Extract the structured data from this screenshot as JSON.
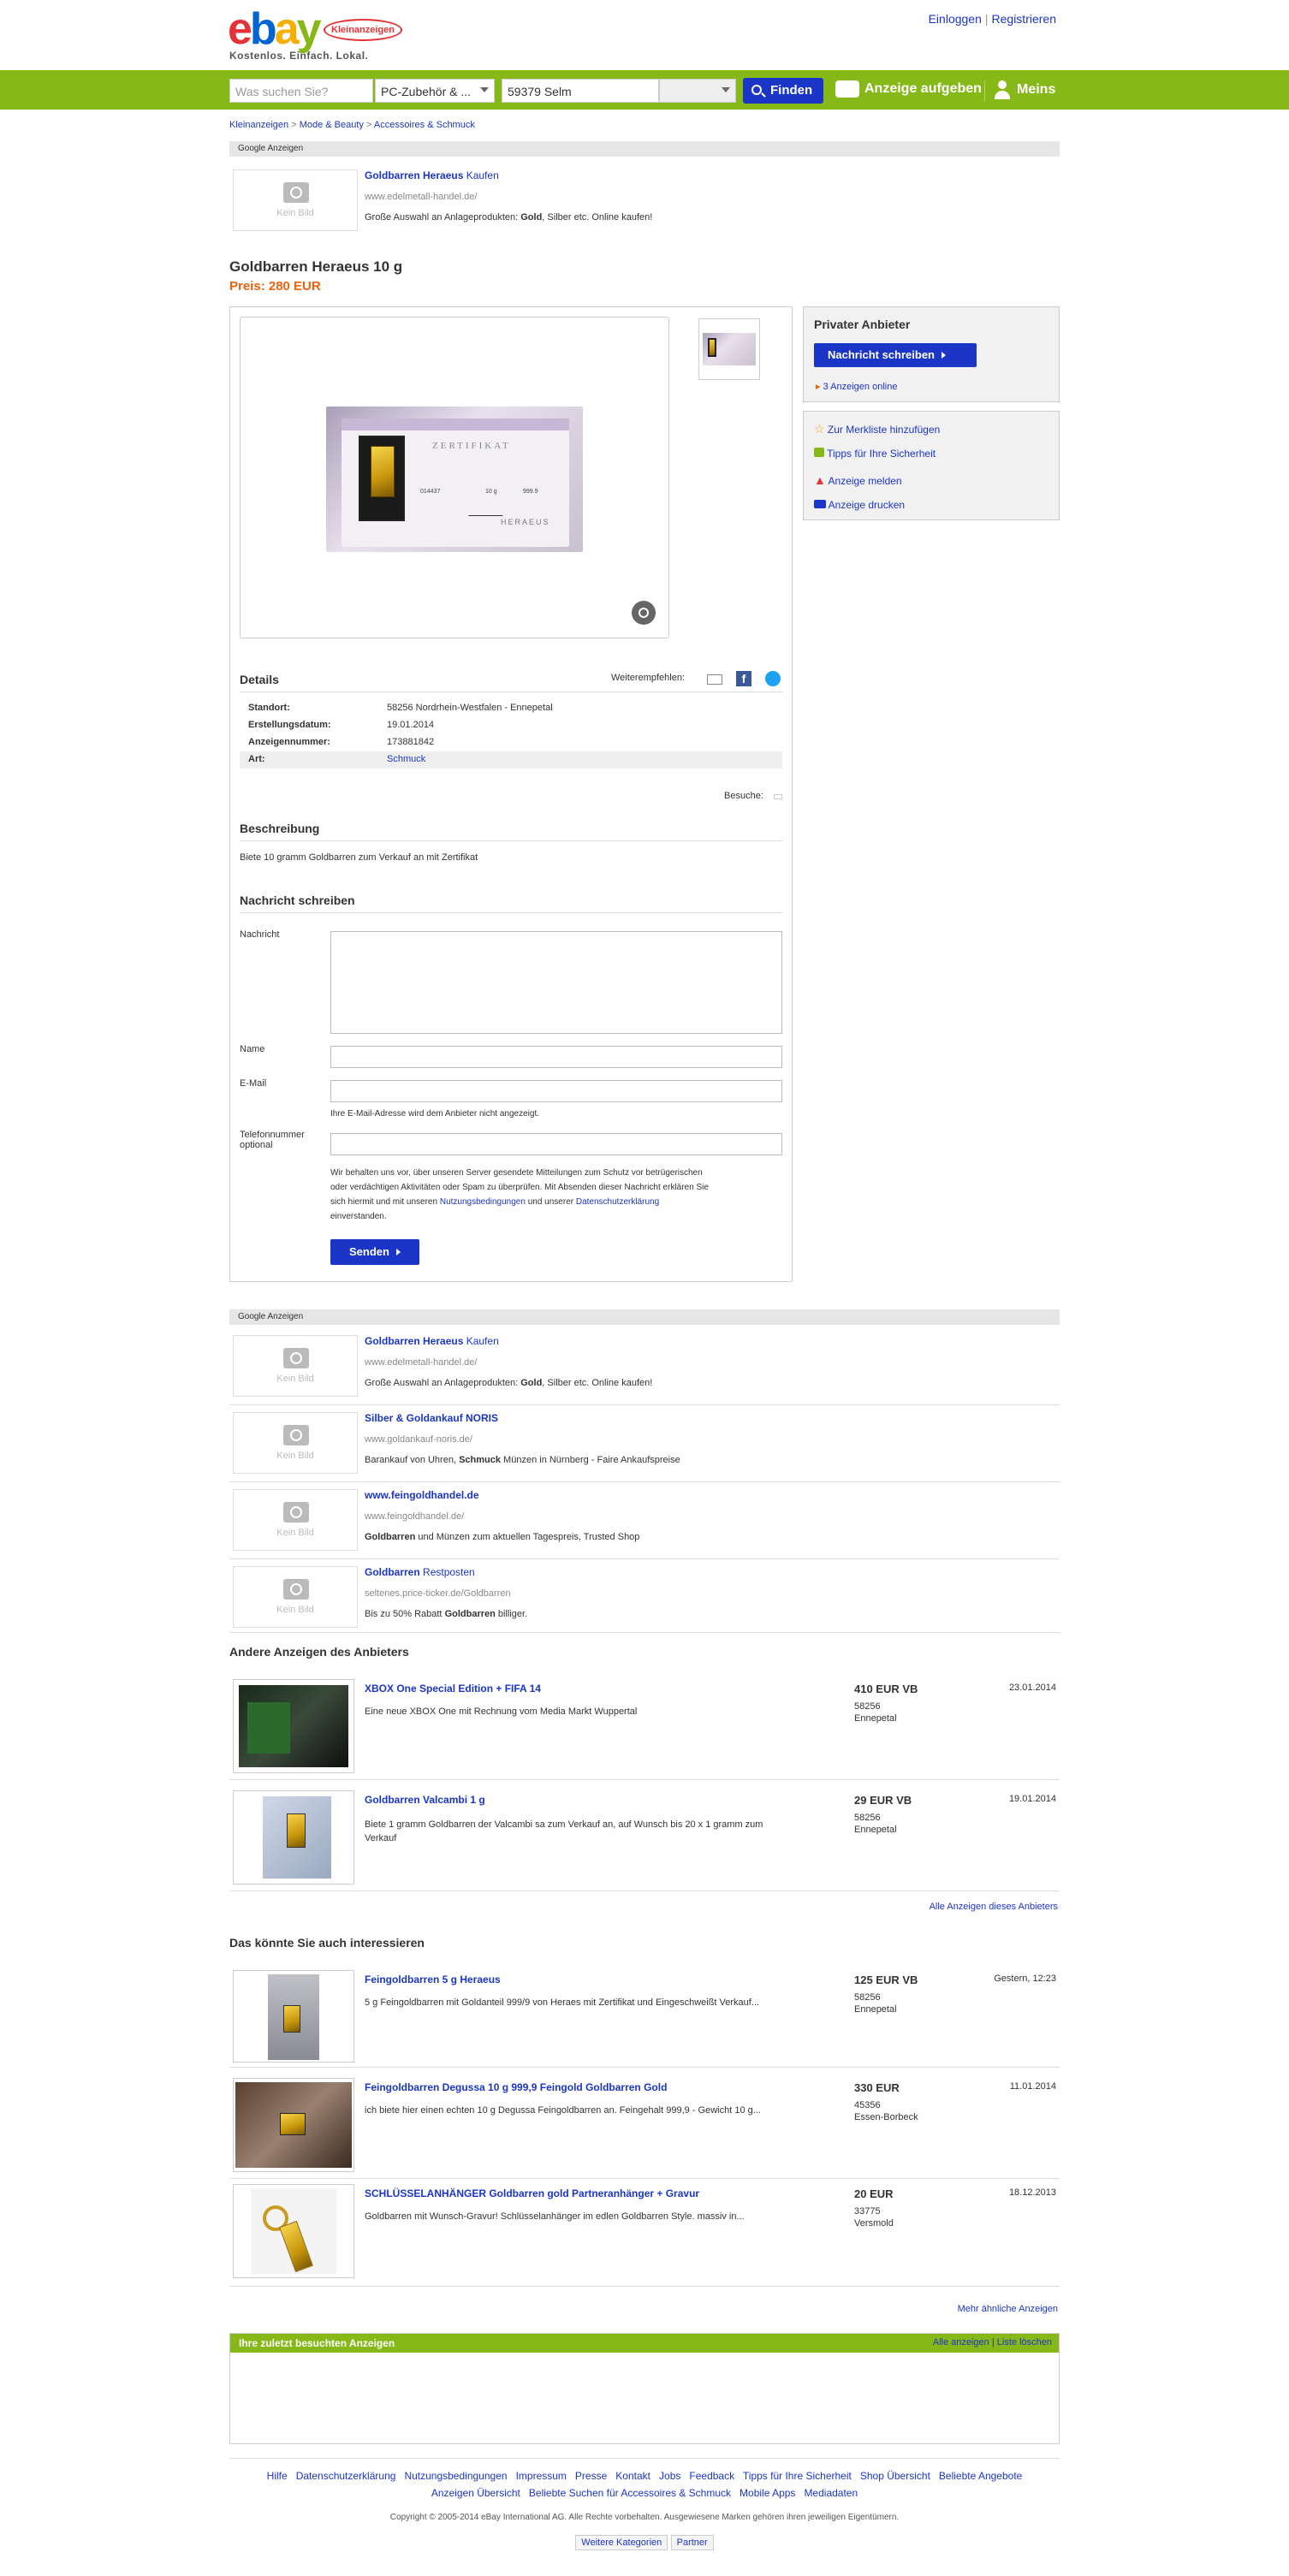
{
  "header": {
    "logo_text": "ebay",
    "logo_badge": "Kleinanzeigen",
    "tagline": "Kostenlos. Einfach. Lokal.",
    "login": "Einloggen",
    "register": "Registrieren",
    "sep": "|"
  },
  "search": {
    "placeholder": "Was suchen Sie?",
    "category": "PC-Zubehör & ...",
    "location": "59379 Selm",
    "find_label": "Finden",
    "post_ad": "Anzeige aufgeben",
    "meins": "Meins"
  },
  "breadcrumb": [
    "Kleinanzeigen",
    "Mode & Beauty",
    "Accessoires & Schmuck"
  ],
  "breadcrumb_sep": ">",
  "google_ads_label": "Google Anzeigen",
  "no_pic": "Kein Bild",
  "top_ad": {
    "title_bold": "Goldbarren Heraeus",
    "title_rest": " Kaufen",
    "url": "www.edelmetall-handel.de/",
    "desc_pre": "Große Auswahl an Anlageprodukten: ",
    "desc_bold": "Gold",
    "desc_post": ", Silber etc. Online kaufen!"
  },
  "listing": {
    "title": "Goldbarren Heraeus 10 g",
    "price": "Preis: 280 EUR"
  },
  "cert": {
    "heading": "ZERTIFIKAT",
    "number": "014437",
    "weight": "10 g",
    "purity": "999.9",
    "brand": "HERAEUS"
  },
  "details": {
    "heading": "Details",
    "share_label": "Weiterempfehlen:",
    "rows": [
      {
        "k": "Standort:",
        "v": "58256 Nordrhein-Westfalen - Ennepetal"
      },
      {
        "k": "Erstellungsdatum:",
        "v": "19.01.2014"
      },
      {
        "k": "Anzeigennummer:",
        "v": "173881842"
      },
      {
        "k": "Art:",
        "v": "Schmuck"
      }
    ],
    "visits": "Besuche:"
  },
  "description": {
    "heading": "Beschreibung",
    "text": "Biete 10 gramm Goldbarren zum Verkauf an mit Zertifikat"
  },
  "message_form": {
    "heading": "Nachricht schreiben",
    "msg_label": "Nachricht",
    "name_label": "Name",
    "email_label": "E-Mail",
    "email_hint": "Ihre E-Mail-Adresse wird dem Anbieter nicht angezeigt.",
    "phone_label_1": "Telefonnummer",
    "phone_label_2": "optional",
    "legal_1": "Wir behalten uns vor, über unseren Server gesendete Mitteilungen zum Schutz vor betrügerischen",
    "legal_2": "oder verdächtigen Aktivitäten oder Spam zu überprüfen. Mit Absenden dieser Nachricht erklären Sie",
    "legal_3_pre": "sich hiermit und mit unseren ",
    "legal_3_link1": "Nutzungsbedingungen",
    "legal_3_mid": " und unserer ",
    "legal_3_link2": "Datenschutzerklärung",
    "legal_4": "einverstanden.",
    "send": "Senden"
  },
  "seller_box": {
    "heading": "Privater Anbieter",
    "contact_btn": "Nachricht schreiben",
    "ads_online": "3 Anzeigen online"
  },
  "actions": [
    {
      "label": "Zur Merkliste hinzufügen",
      "icon": "star-icon"
    },
    {
      "label": "Tipps für Ihre Sicherheit",
      "icon": "lock-icon"
    },
    {
      "label": "Anzeige melden",
      "icon": "warning-icon"
    },
    {
      "label": "Anzeige drucken",
      "icon": "printer-icon"
    }
  ],
  "bottom_ads": [
    {
      "t_bold": "Goldbarren Heraeus",
      "t_rest": " Kaufen",
      "url": "www.edelmetall-handel.de/",
      "d_pre": "Große Auswahl an Anlageprodukten: ",
      "d_bold": "Gold",
      "d_post": ", Silber etc. Online kaufen!"
    },
    {
      "t_bold": "Silber & Goldankauf NORIS",
      "t_rest": "",
      "url": "www.goldankauf-noris.de/",
      "d_pre": "Barankauf von Uhren, ",
      "d_bold": "Schmuck",
      "d_post": " Münzen in Nürnberg - Faire Ankaufspreise"
    },
    {
      "t_bold": "www.feingoldhandel.de",
      "t_rest": "",
      "url": "www.feingoldhandel.de/",
      "d_pre": "",
      "d_bold": "Goldbarren",
      "d_post": " und Münzen zum aktuellen Tagespreis, Trusted Shop"
    },
    {
      "t_bold": "Goldbarren",
      "t_rest": " Restposten",
      "url": "seltenes.price-ticker.de/Goldbarren",
      "d_pre": "Bis zu 50% Rabatt ",
      "d_bold": "Goldbarren",
      "d_post": " billiger."
    }
  ],
  "seller_ads": {
    "heading": "Andere Anzeigen des Anbieters",
    "items": [
      {
        "title": "XBOX One Special Edition + FIFA 14",
        "desc": "Eine neue XBOX One mit Rechnung vom Media Markt Wuppertal",
        "desc2": "",
        "price": "410 EUR VB",
        "zip": "58256",
        "city": "Ennepetal",
        "date": "23.01.2014"
      },
      {
        "title": "Goldbarren Valcambi 1 g",
        "desc": "Biete 1 gramm Goldbarren der Valcambi sa zum Verkauf an, auf Wunsch bis 20 x 1 gramm zum",
        "desc2": "Verkauf",
        "price": "29 EUR VB",
        "zip": "58256",
        "city": "Ennepetal",
        "date": "19.01.2014"
      }
    ],
    "all_link": "Alle Anzeigen dieses Anbieters"
  },
  "similar": {
    "heading": "Das könnte Sie auch interessieren",
    "items": [
      {
        "title": "Feingoldbarren 5 g Heraeus",
        "desc": "5 g Feingoldbarren mit Goldanteil 999/9 von Heraes mit Zertifikat und Eingeschweißt Verkauf...",
        "price": "125 EUR VB",
        "zip": "58256",
        "city": "Ennepetal",
        "date": "Gestern, 12:23"
      },
      {
        "title": "Feingoldbarren Degussa 10 g 999,9 Feingold Goldbarren Gold",
        "desc": "ich biete hier einen echten 10 g Degussa Feingoldbarren an. Feingehalt 999,9 - Gewicht 10 g...",
        "price": "330 EUR",
        "zip": "45356",
        "city": "Essen-Borbeck",
        "date": "11.01.2014"
      },
      {
        "title": "SCHLÜSSELANHÄNGER Goldbarren gold Partneranhänger + Gravur",
        "desc": "Goldbarren mit Wunsch-Gravur! Schlüsselanhänger im edlen Goldbarren Style. massiv in...",
        "price": "20 EUR",
        "zip": "33775",
        "city": "Versmold",
        "date": "18.12.2013"
      }
    ],
    "more_link": "Mehr ähnliche Anzeigen"
  },
  "recent": {
    "heading": "Ihre zuletzt besuchten Anzeigen",
    "all": "Alle anzeigen",
    "sep": "|",
    "clear": "Liste löschen"
  },
  "footer": {
    "row1": [
      "Hilfe",
      "Datenschutzerklärung",
      "Nutzungsbedingungen",
      "Impressum",
      "Presse",
      "Kontakt",
      "Jobs",
      "Feedback",
      "Tipps für Ihre Sicherheit",
      "Shop Übersicht",
      "Beliebte Angebote"
    ],
    "row2": [
      "Anzeigen Übersicht",
      "Beliebte Suchen für Accessoires & Schmuck",
      "Mobile Apps",
      "Mediadaten"
    ],
    "copyright": "Copyright © 2005-2014 eBay International AG. Alle Rechte vorbehalten. Ausgewiesene Marken gehören ihren jeweiligen Eigentümern.",
    "btn1": "Weitere Kategorien",
    "btn2": "Partner"
  },
  "colors": {
    "green": "#86b817",
    "blue": "#1b35c7",
    "price_orange": "#f1610c"
  }
}
